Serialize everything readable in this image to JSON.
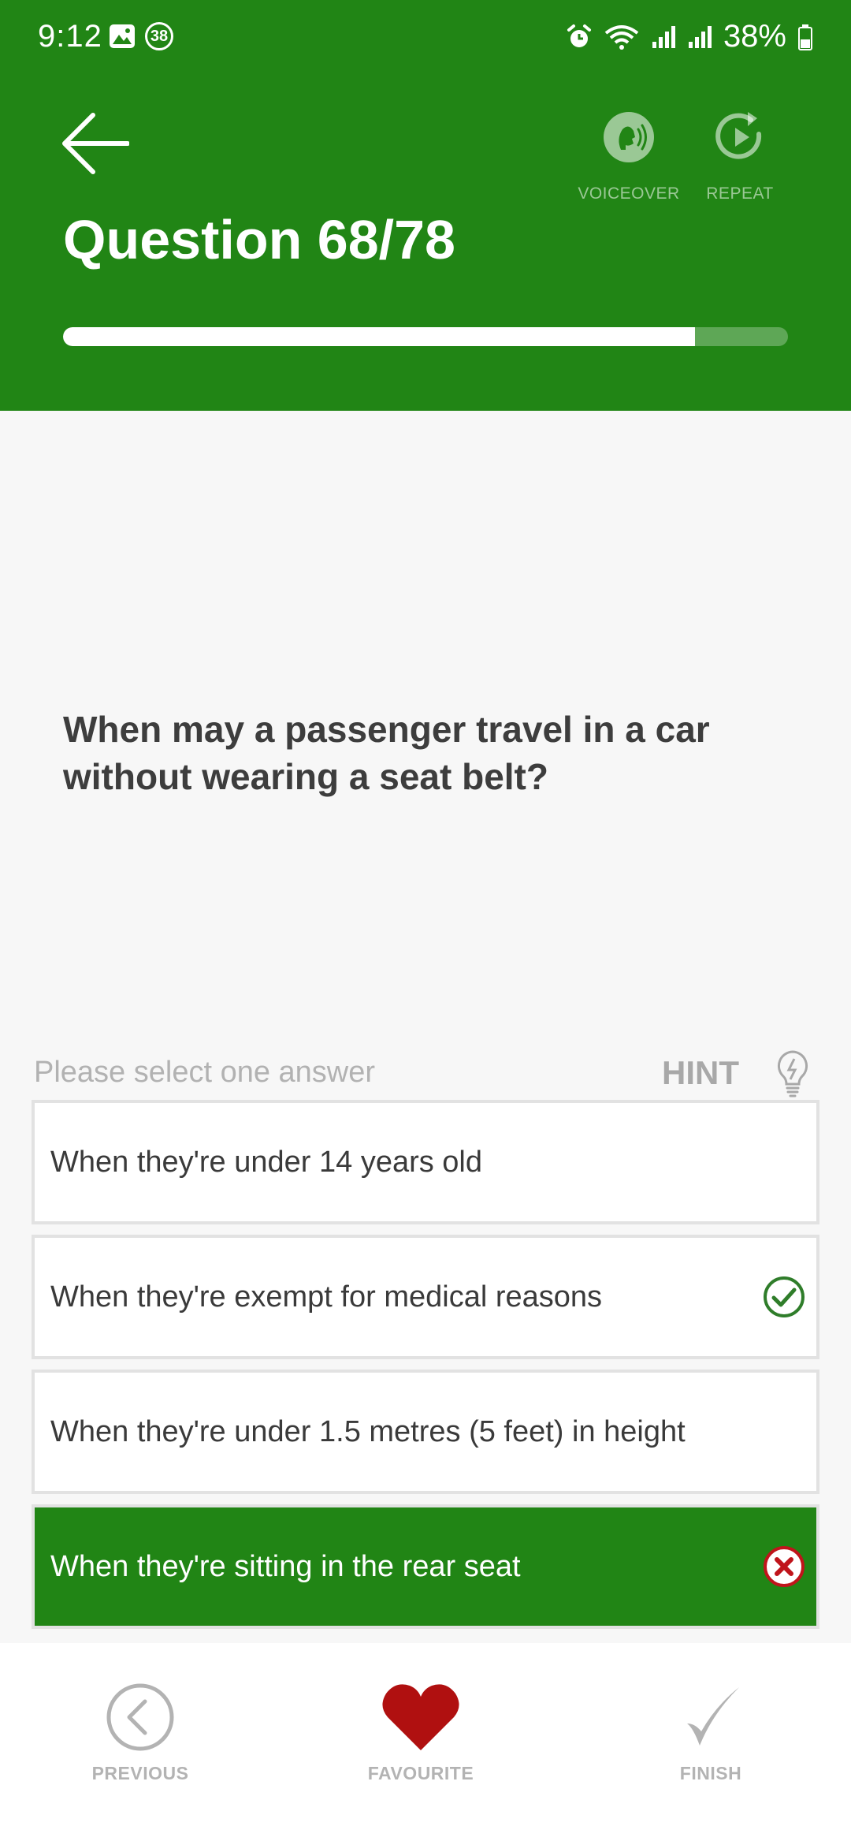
{
  "status_bar": {
    "time": "9:12",
    "badge": "38",
    "battery": "38%"
  },
  "header": {
    "voiceover_label": "VOICEOVER",
    "repeat_label": "REPEAT",
    "title": "Question 68/78",
    "progress": 0.872,
    "bg_color": "#218515"
  },
  "question": {
    "text": "When may a passenger travel in a car without wearing a seat belt?"
  },
  "prompt": {
    "text": "Please select one answer",
    "hint_label": "HINT"
  },
  "answers": [
    {
      "text": "When they're under 14 years old",
      "state": "none"
    },
    {
      "text": "When they're exempt for medical reasons",
      "state": "correct"
    },
    {
      "text": "When they're under 1.5 metres (5 feet) in height",
      "state": "none"
    },
    {
      "text": "When they're sitting in the rear seat",
      "state": "selected-wrong"
    }
  ],
  "bottom_nav": {
    "previous_label": "PREVIOUS",
    "favourite_label": "FAVOURITE",
    "finish_label": "FINISH",
    "favourite_color": "#b01010"
  }
}
